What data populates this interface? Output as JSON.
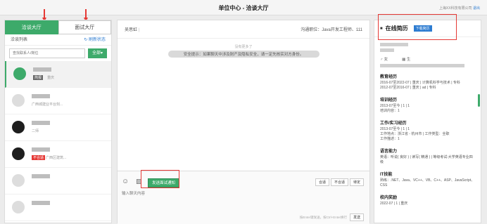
{
  "header": {
    "title": "单位中心 - 洽谈大厅",
    "user_info": "上海XX科技有限公司",
    "logout": "退出"
  },
  "left": {
    "tab_chat": "洽谈大厅",
    "tab_interview": "面试大厅",
    "list_title": "洽谈列表",
    "refresh": "刷新状态",
    "search_placeholder": "查找联系人/岗位",
    "filter_all": "全部▾",
    "contacts": [
      {
        "tag": "简报",
        "sub": "重庆",
        "active": true
      },
      {
        "tag": "",
        "sub": "广西城建业平台刻...",
        "active": false
      },
      {
        "tag": "",
        "sub": "二师",
        "active": false
      },
      {
        "tag": "不合适",
        "sub": "广西区建筑...",
        "active": false
      },
      {
        "tag": "",
        "sub": "",
        "active": false
      },
      {
        "tag": "",
        "sub": "",
        "active": false
      }
    ]
  },
  "chat": {
    "contact_name": "吴思虹",
    "contact_meta": "|",
    "position": "沟通职位：Java开发工程师、111",
    "no_more": "没有更多了",
    "notice": "安全提示：如果聊天中涉及财产及隐私安全，请一定先核实对方身份。",
    "invite_label": "发送面试通知",
    "decisions": [
      "合适",
      "不合适",
      "待定"
    ],
    "placeholder": "输入聊天内容",
    "hint": "按Enter键发送，按Ctrl+Enter换行",
    "send": "发送"
  },
  "resume": {
    "title": "在线简历",
    "download": "下载简历",
    "gender": "女",
    "birth": "生",
    "sections": [
      {
        "heading": "教育经历",
        "lines": [
          "2016-07至2022-07 | 重庆 | 计算机科学与技术 | 专科",
          "2012-07至2016-07 | 重庆 | ad | 专科"
        ]
      },
      {
        "heading": "培训经历",
        "lines": [
          "2013-07至今 | 1 | 1",
          "培训内容：1"
        ]
      },
      {
        "heading": "工作/实习经历",
        "lines": [
          "2013-07至今 | 1 | 1",
          "工作地点：浙江省 - 杭州市 | 工作类型：全职",
          "工作描述：1"
        ]
      },
      {
        "heading": "语言能力",
        "lines": [
          "英语：听说( 良好 ) | 读写( 精通 ) | 等级考试:大学英语专业四级"
        ]
      },
      {
        "heading": "IT技能",
        "lines": [
          "熟练：.NET、Java、VC++、VB、C++、ASP、JavaScript、CSS"
        ]
      },
      {
        "heading": "校内奖励",
        "lines": [
          "2022-07 | 1 | 重庆"
        ]
      }
    ]
  }
}
